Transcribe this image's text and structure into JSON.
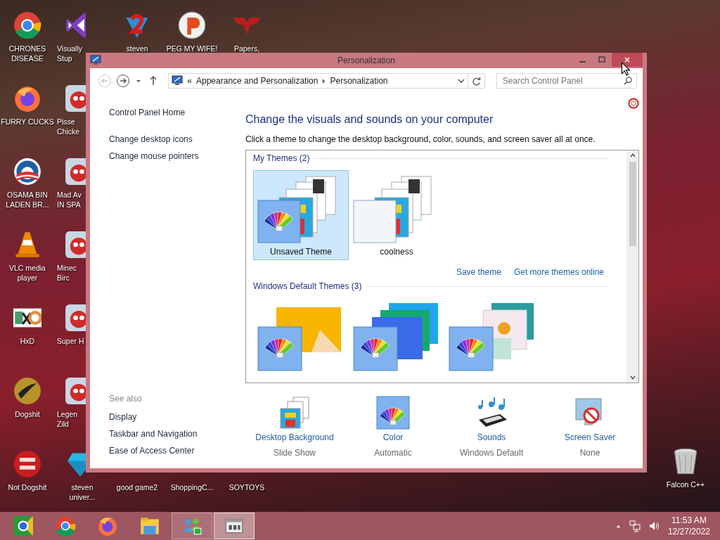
{
  "desktop": {
    "columns": [
      [
        {
          "label": "CHRONES\nDISEASE",
          "kind": "chrome"
        },
        {
          "label": "FURRY CUCKS",
          "kind": "firefox"
        },
        {
          "label": "OSAMA BIN\nLADEN BR...",
          "kind": "obama"
        },
        {
          "label": "VLC media\nplayer",
          "kind": "cone"
        },
        {
          "label": "HxD",
          "kind": "hxd"
        },
        {
          "label": "Dogshit",
          "kind": "disc"
        },
        {
          "label": "Not Dogshit",
          "kind": "devcpp"
        }
      ],
      [
        {
          "label": "Visually\nStup",
          "kind": "vs"
        },
        {
          "label": "Pisse\nChicke",
          "kind": "tile"
        },
        {
          "label": "Mad Av\nIN SPA",
          "kind": "tile"
        },
        {
          "label": "Minec\nBirc",
          "kind": "tile"
        },
        {
          "label": "Super H",
          "kind": "tile"
        },
        {
          "label": "Legen\nZild",
          "kind": "tile"
        },
        {
          "label": "steven\nuniver...",
          "kind": "diamond"
        }
      ],
      [
        {
          "label": "steven",
          "kind": "gem"
        },
        {
          "label": "good game2"
        }
      ],
      [
        {
          "label": "PEG MY WIFE!",
          "kind": "pball"
        },
        {
          "label": "ShoppingC..."
        }
      ],
      [
        {
          "label": "Papers,",
          "kind": "papers"
        },
        {
          "label": "SOYTOYS"
        }
      ]
    ],
    "corner_icon": {
      "label": "Falcon C++",
      "kind": "bin"
    }
  },
  "window": {
    "title": "Personalization",
    "address": {
      "overflow": "«",
      "crumbs": [
        "Appearance and Personalization",
        "Personalization"
      ]
    },
    "search": {
      "placeholder": "Search Control Panel"
    },
    "sidebar": {
      "links": [
        "Control Panel Home",
        "Change desktop icons",
        "Change mouse pointers"
      ],
      "see_also": {
        "heading": "See also",
        "links": [
          "Display",
          "Taskbar and Navigation",
          "Ease of Access Center"
        ]
      }
    },
    "heading": "Change the visuals and sounds on your computer",
    "description": "Click a theme to change the desktop background, color, sounds, and screen saver all at once.",
    "theme_groups": [
      {
        "title": "My Themes (2)",
        "themes": [
          {
            "name": "Unsaved Theme",
            "kind": "custom",
            "selected": true
          },
          {
            "name": "coolness",
            "kind": "custom-plain",
            "selected": false
          }
        ],
        "links": [
          "Save theme",
          "Get more themes online"
        ]
      },
      {
        "title": "Windows Default Themes (3)",
        "themes": [
          {
            "kind": "windows",
            "selected": false
          },
          {
            "kind": "lines",
            "selected": false
          },
          {
            "kind": "flowers",
            "selected": false
          }
        ]
      }
    ],
    "settings": [
      {
        "label": "Desktop Background",
        "value": "Slide Show",
        "kind": "background"
      },
      {
        "label": "Color",
        "value": "Automatic",
        "kind": "color"
      },
      {
        "label": "Sounds",
        "value": "Windows Default",
        "kind": "sounds"
      },
      {
        "label": "Screen Saver",
        "value": "None",
        "kind": "screensaver"
      }
    ]
  },
  "taskbar": {
    "apps": [
      {
        "kind": "chrome-alt",
        "running": false,
        "selected": false
      },
      {
        "kind": "chrome",
        "running": false,
        "selected": false
      },
      {
        "kind": "firefox",
        "running": false,
        "selected": false
      },
      {
        "kind": "explorer",
        "running": false,
        "selected": false
      },
      {
        "kind": "people",
        "running": true,
        "selected": false
      },
      {
        "kind": "control-panel",
        "running": true,
        "selected": true
      }
    ],
    "tray": {
      "time": "11:53 AM",
      "date": "12/27/2022"
    }
  }
}
